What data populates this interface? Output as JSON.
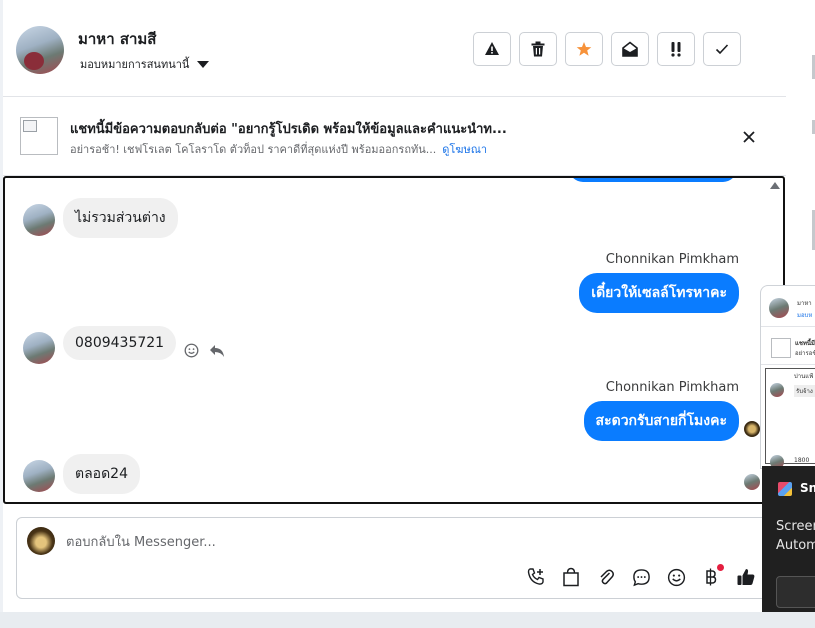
{
  "header": {
    "contact_name": "มาหา สามสี",
    "assign_label": "มอบหมายการสนทนานี้",
    "actions": [
      {
        "name": "report-button",
        "icon": "warning-icon"
      },
      {
        "name": "delete-button",
        "icon": "trash-icon"
      },
      {
        "name": "star-button",
        "icon": "star-icon",
        "color": "#f7923a"
      },
      {
        "name": "mark-unread-button",
        "icon": "envelope-open-icon"
      },
      {
        "name": "important-button",
        "icon": "exclamation-icon"
      },
      {
        "name": "done-button",
        "icon": "check-icon"
      }
    ]
  },
  "ad_banner": {
    "title": "แชทนี้มีข้อความตอบกลับต่อ \"อยากรู้โปรเดิด พร้อมให้ข้อมูลและคำแนะนำท...",
    "subtitle": "อย่ารอช้า! เชฟโรเลต โคโลราโด ตัวท็อป ราคาดีที่สุดแห่งปี พร้อมออกรถทัน...",
    "link": "ดูโฆษณา"
  },
  "messages": [
    {
      "type": "in",
      "text": "ไม่รวมส่วนต่าง"
    },
    {
      "type": "out",
      "sender": "Chonnikan Pimkham",
      "text": "เดี๋ยวให้เซลล์โทรหาคะ"
    },
    {
      "type": "in",
      "text": "0809435721"
    },
    {
      "type": "out",
      "sender": "Chonnikan Pimkham",
      "text": "สะดวกรับสายกี่โมงคะ"
    },
    {
      "type": "in",
      "text": "ตลอด24"
    }
  ],
  "reply": {
    "placeholder": "ตอบกลับใน Messenger..."
  },
  "floating_window": {
    "name_snip": "มาหา",
    "label_snip": "มอบห",
    "ad_snip": "แชทนี้มี",
    "ad_sub_snip": "อย่ารอช้า",
    "msg_snip": "บ่านแฟ้",
    "msg2_snip": "รับจ้าง",
    "phone_snip": "1800"
  },
  "snip_toast": {
    "title": "Sni",
    "body_line1": "Screen",
    "body_line2": "Autom"
  },
  "colors": {
    "accent": "#0a7cff",
    "star": "#f7923a",
    "link": "#1a73e8"
  }
}
